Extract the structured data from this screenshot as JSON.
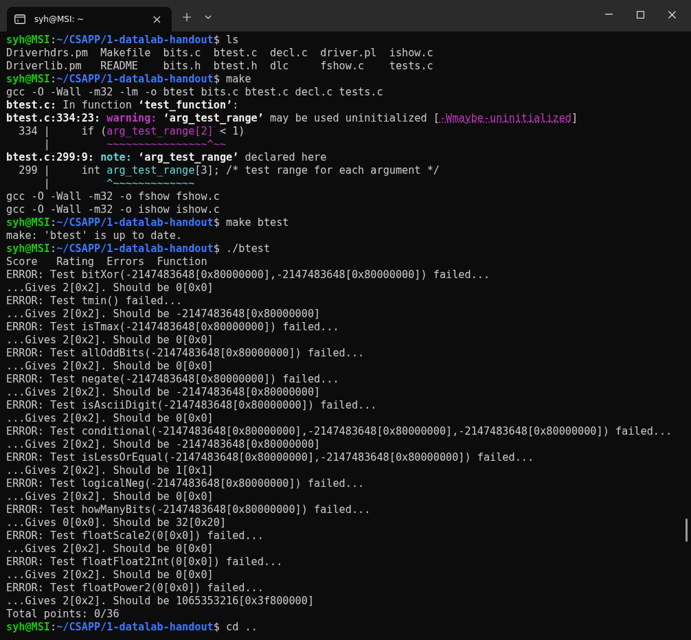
{
  "window": {
    "tab_title": "syh@MSI: ~"
  },
  "terminal": {
    "lines": [
      [
        {
          "kind": "user",
          "text": "syh@MSI"
        },
        {
          "kind": "plain",
          "text": ":"
        },
        {
          "kind": "path",
          "text": "~/CSAPP/1-datalab-handout"
        },
        {
          "kind": "plain",
          "text": "$ ls"
        }
      ],
      [
        {
          "kind": "plain",
          "text": "Driverhdrs.pm  Makefile  bits.c  btest.c  decl.c  driver.pl  ishow.c"
        }
      ],
      [
        {
          "kind": "plain",
          "text": "Driverlib.pm   README    bits.h  btest.h  dlc     fshow.c    tests.c"
        }
      ],
      [
        {
          "kind": "user",
          "text": "syh@MSI"
        },
        {
          "kind": "plain",
          "text": ":"
        },
        {
          "kind": "path",
          "text": "~/CSAPP/1-datalab-handout"
        },
        {
          "kind": "plain",
          "text": "$ make"
        }
      ],
      [
        {
          "kind": "plain",
          "text": "gcc -O -Wall -m32 -lm -o btest bits.c btest.c decl.c tests.c"
        }
      ],
      [
        {
          "kind": "bold",
          "text": "btest.c:"
        },
        {
          "kind": "plain",
          "text": " In function "
        },
        {
          "kind": "bold",
          "text": "‘test_function’"
        },
        {
          "kind": "plain",
          "text": ":"
        }
      ],
      [
        {
          "kind": "bold",
          "text": "btest.c:334:23: "
        },
        {
          "kind": "warning",
          "text": "warning:"
        },
        {
          "kind": "bold",
          "text": " ‘arg_test_range’"
        },
        {
          "kind": "plain",
          "text": " may be used uninitialized ["
        },
        {
          "kind": "flag",
          "text": "-Wmaybe-uninitialized"
        },
        {
          "kind": "plain",
          "text": "]"
        }
      ],
      [
        {
          "kind": "plain",
          "text": "  334 |     if ("
        },
        {
          "kind": "magenta",
          "text": "arg_test_range[2]"
        },
        {
          "kind": "plain",
          "text": " < 1)"
        }
      ],
      [
        {
          "kind": "plain",
          "text": "      |         "
        },
        {
          "kind": "magenta",
          "text": "~~~~~~~~~~~~~~~~^~~"
        }
      ],
      [
        {
          "kind": "bold",
          "text": "btest.c:299:9: "
        },
        {
          "kind": "note",
          "text": "note:"
        },
        {
          "kind": "bold",
          "text": " ‘arg_test_range’"
        },
        {
          "kind": "plain",
          "text": " declared here"
        }
      ],
      [
        {
          "kind": "plain",
          "text": "  299 |     int "
        },
        {
          "kind": "cyan",
          "text": "arg_test_range"
        },
        {
          "kind": "plain",
          "text": "[3]; /* test range for each argument */"
        }
      ],
      [
        {
          "kind": "plain",
          "text": "      |         "
        },
        {
          "kind": "cyan",
          "text": "^~~~~~~~~~~~~~"
        }
      ],
      [
        {
          "kind": "plain",
          "text": "gcc -O -Wall -m32 -o fshow fshow.c"
        }
      ],
      [
        {
          "kind": "plain",
          "text": "gcc -O -Wall -m32 -o ishow ishow.c"
        }
      ],
      [
        {
          "kind": "user",
          "text": "syh@MSI"
        },
        {
          "kind": "plain",
          "text": ":"
        },
        {
          "kind": "path",
          "text": "~/CSAPP/1-datalab-handout"
        },
        {
          "kind": "plain",
          "text": "$ make btest"
        }
      ],
      [
        {
          "kind": "plain",
          "text": "make: 'btest' is up to date."
        }
      ],
      [
        {
          "kind": "user",
          "text": "syh@MSI"
        },
        {
          "kind": "plain",
          "text": ":"
        },
        {
          "kind": "path",
          "text": "~/CSAPP/1-datalab-handout"
        },
        {
          "kind": "plain",
          "text": "$ ./btest"
        }
      ],
      [
        {
          "kind": "plain",
          "text": "Score   Rating  Errors  Function"
        }
      ],
      [
        {
          "kind": "plain",
          "text": "ERROR: Test bitXor(-2147483648[0x80000000],-2147483648[0x80000000]) failed..."
        }
      ],
      [
        {
          "kind": "plain",
          "text": "...Gives 2[0x2]. Should be 0[0x0]"
        }
      ],
      [
        {
          "kind": "plain",
          "text": "ERROR: Test tmin() failed..."
        }
      ],
      [
        {
          "kind": "plain",
          "text": "...Gives 2[0x2]. Should be -2147483648[0x80000000]"
        }
      ],
      [
        {
          "kind": "plain",
          "text": "ERROR: Test isTmax(-2147483648[0x80000000]) failed..."
        }
      ],
      [
        {
          "kind": "plain",
          "text": "...Gives 2[0x2]. Should be 0[0x0]"
        }
      ],
      [
        {
          "kind": "plain",
          "text": "ERROR: Test allOddBits(-2147483648[0x80000000]) failed..."
        }
      ],
      [
        {
          "kind": "plain",
          "text": "...Gives 2[0x2]. Should be 0[0x0]"
        }
      ],
      [
        {
          "kind": "plain",
          "text": "ERROR: Test negate(-2147483648[0x80000000]) failed..."
        }
      ],
      [
        {
          "kind": "plain",
          "text": "...Gives 2[0x2]. Should be -2147483648[0x80000000]"
        }
      ],
      [
        {
          "kind": "plain",
          "text": "ERROR: Test isAsciiDigit(-2147483648[0x80000000]) failed..."
        }
      ],
      [
        {
          "kind": "plain",
          "text": "...Gives 2[0x2]. Should be 0[0x0]"
        }
      ],
      [
        {
          "kind": "plain",
          "text": "ERROR: Test conditional(-2147483648[0x80000000],-2147483648[0x80000000],-2147483648[0x80000000]) failed..."
        }
      ],
      [
        {
          "kind": "plain",
          "text": "...Gives 2[0x2]. Should be -2147483648[0x80000000]"
        }
      ],
      [
        {
          "kind": "plain",
          "text": "ERROR: Test isLessOrEqual(-2147483648[0x80000000],-2147483648[0x80000000]) failed..."
        }
      ],
      [
        {
          "kind": "plain",
          "text": "...Gives 2[0x2]. Should be 1[0x1]"
        }
      ],
      [
        {
          "kind": "plain",
          "text": "ERROR: Test logicalNeg(-2147483648[0x80000000]) failed..."
        }
      ],
      [
        {
          "kind": "plain",
          "text": "...Gives 2[0x2]. Should be 0[0x0]"
        }
      ],
      [
        {
          "kind": "plain",
          "text": "ERROR: Test howManyBits(-2147483648[0x80000000]) failed..."
        }
      ],
      [
        {
          "kind": "plain",
          "text": "...Gives 0[0x0]. Should be 32[0x20]"
        }
      ],
      [
        {
          "kind": "plain",
          "text": "ERROR: Test floatScale2(0[0x0]) failed..."
        }
      ],
      [
        {
          "kind": "plain",
          "text": "...Gives 2[0x2]. Should be 0[0x0]"
        }
      ],
      [
        {
          "kind": "plain",
          "text": "ERROR: Test floatFloat2Int(0[0x0]) failed..."
        }
      ],
      [
        {
          "kind": "plain",
          "text": "...Gives 2[0x2]. Should be 0[0x0]"
        }
      ],
      [
        {
          "kind": "plain",
          "text": "ERROR: Test floatPower2(0[0x0]) failed..."
        }
      ],
      [
        {
          "kind": "plain",
          "text": "...Gives 2[0x2]. Should be 1065353216[0x3f800000]"
        }
      ],
      [
        {
          "kind": "plain",
          "text": "Total points: 0/36"
        }
      ],
      [
        {
          "kind": "user",
          "text": "syh@MSI"
        },
        {
          "kind": "plain",
          "text": ":"
        },
        {
          "kind": "path",
          "text": "~/CSAPP/1-datalab-handout"
        },
        {
          "kind": "plain",
          "text": "$ cd .."
        }
      ]
    ]
  }
}
